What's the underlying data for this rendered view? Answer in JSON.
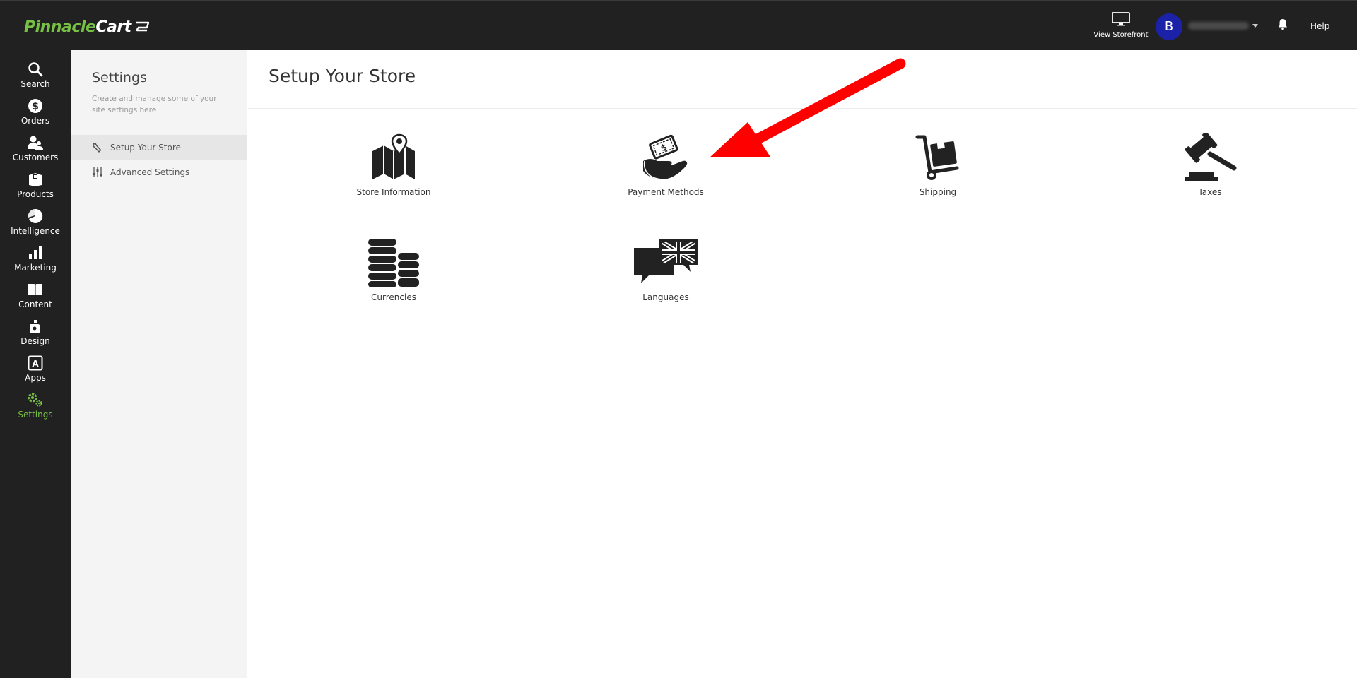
{
  "brand": {
    "name_part1": "Pinnacle",
    "name_part2": "Cart"
  },
  "topbar": {
    "view_storefront": "View Storefront",
    "avatar_initial": "B",
    "help": "Help"
  },
  "nav": [
    {
      "label": "Search",
      "icon": "search-icon"
    },
    {
      "label": "Orders",
      "icon": "dollar-icon"
    },
    {
      "label": "Customers",
      "icon": "customers-icon"
    },
    {
      "label": "Products",
      "icon": "box-icon"
    },
    {
      "label": "Intelligence",
      "icon": "pie-chart-icon"
    },
    {
      "label": "Marketing",
      "icon": "bar-chart-icon"
    },
    {
      "label": "Content",
      "icon": "book-icon"
    },
    {
      "label": "Design",
      "icon": "design-icon"
    },
    {
      "label": "Apps",
      "icon": "apps-icon"
    },
    {
      "label": "Settings",
      "icon": "gear-icon",
      "active": true
    }
  ],
  "settings_panel": {
    "title": "Settings",
    "description": "Create and manage some of your site settings here",
    "items": [
      {
        "label": "Setup Your Store",
        "icon": "wrench-icon",
        "active": true
      },
      {
        "label": "Advanced Settings",
        "icon": "sliders-icon"
      }
    ]
  },
  "main": {
    "title": "Setup Your Store",
    "tiles": [
      {
        "label": "Store Information",
        "icon": "map-pin-icon"
      },
      {
        "label": "Payment Methods",
        "icon": "money-hand-icon"
      },
      {
        "label": "Shipping",
        "icon": "hand-truck-icon"
      },
      {
        "label": "Taxes",
        "icon": "gavel-icon"
      },
      {
        "label": "Currencies",
        "icon": "coins-icon"
      },
      {
        "label": "Languages",
        "icon": "language-flag-icon"
      }
    ]
  },
  "colors": {
    "brand_green": "#76c043",
    "dark_bg": "#212121",
    "avatar_blue": "#1b22a8",
    "annotation_red": "#ff0000"
  }
}
